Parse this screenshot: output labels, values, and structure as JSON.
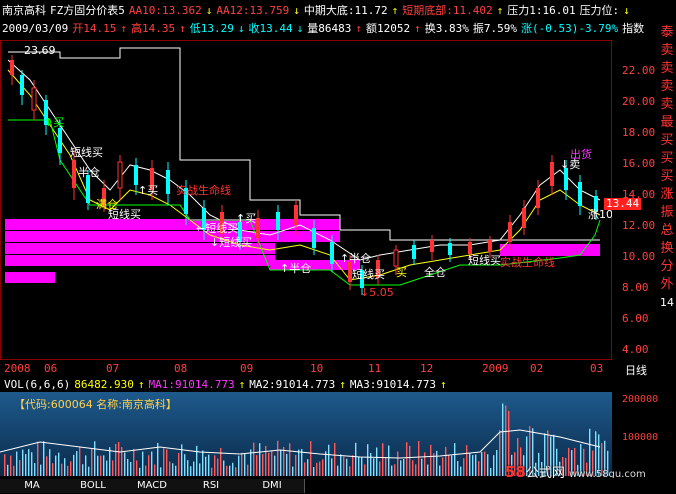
{
  "header": {
    "stock_name": "南京高科",
    "formula": "FZ方固分价表5",
    "aa10": "AA10:13.362",
    "aa10_arrow": "↓",
    "aa12": "AA12:13.759",
    "aa12_arrow": "↓",
    "mid_bottom": "中期大底:11.72",
    "mid_bottom_arrow": "↑",
    "short_bottom": "短期底部:11.402",
    "short_bottom_arrow": "↑",
    "pressure1": "压力1:16.01",
    "pressure_level": "压力位:",
    "pressure_level_arrow": "↓"
  },
  "quote": {
    "date": "2009/03/09",
    "open": "开14.15",
    "open_arrow": "↑",
    "high": "高14.35",
    "high_arrow": "↑",
    "low": "低13.29",
    "low_arrow": "↓",
    "close": "收13.44",
    "close_arrow": "↓",
    "volume": "量86483",
    "volume_arrow": "↑",
    "amount": "额12052",
    "amount_arrow": "↑",
    "turnover": "换3.83%",
    "amplitude": "振7.59%",
    "change": "涨(-0.53)-3.79%",
    "index_label": "指数"
  },
  "main_chart": {
    "top_price_label": "23.69",
    "current_price": "13.44",
    "y_ticks": [
      "22.00",
      "20.00",
      "18.00",
      "16.00",
      "14.00",
      "12.00",
      "10.00",
      "8.00",
      "6.00",
      "4.00"
    ],
    "annotations": [
      "↑买",
      "短线买",
      "半仓",
      "满仓",
      "短线买",
      "↑买",
      "←短线买",
      "↓短线买",
      "实战生命线",
      "↑买",
      "↑半仓",
      "短线买",
      "短线买",
      "实战生命线",
      "↑半仓",
      "买",
      "全仓",
      "↓5.05",
      "出货",
      "↓卖",
      "涨10"
    ],
    "colors": {
      "candle_up": "#ff3333",
      "candle_down": "#00ffff",
      "band": "#ff00ff",
      "line_white": "#ffffff",
      "line_yellow": "#ffff00",
      "line_green": "#00ff00"
    }
  },
  "date_axis": {
    "labels": [
      "2008",
      "06",
      "07",
      "08",
      "09",
      "10",
      "11",
      "12",
      "2009",
      "02",
      "03"
    ],
    "mode": "日线"
  },
  "side_menu": {
    "items": [
      "泰",
      "卖",
      "卖",
      "卖",
      "卖",
      "最",
      "买",
      "买",
      "买",
      "涨",
      "振",
      "总",
      "换",
      "分",
      "外"
    ],
    "bottom": "14"
  },
  "volume": {
    "header_label": "VOL(6,6,6)",
    "value": "86482.930",
    "value_arrow": "↑",
    "ma1": "MA1:91014.773",
    "ma1_arrow": "↑",
    "ma2": "MA2:91014.773",
    "ma2_arrow": "↑",
    "ma3": "MA3:91014.773",
    "ma3_arrow": "↑",
    "info": "【代码:600064 名称:南京高科】",
    "axis_top": "200000",
    "axis_mid": "100000"
  },
  "tabs": [
    "MA",
    "BOLL",
    "MACD",
    "RSI",
    "DMI"
  ],
  "watermark": {
    "number": "58",
    "text": "公式网",
    "url": "www.58gu.com"
  }
}
